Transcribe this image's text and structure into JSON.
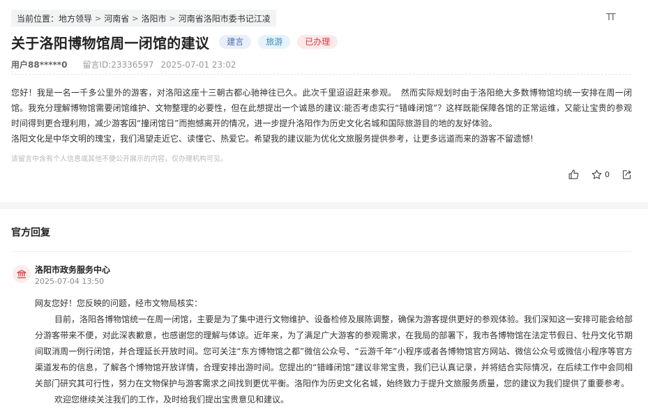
{
  "breadcrumb": {
    "prefix": "当前位置：",
    "items": [
      "地方领导",
      "河南省",
      "洛阳市",
      "河南省洛阳市委书记江凌"
    ]
  },
  "font_size_button": "TT",
  "message": {
    "title": "关于洛阳博物馆周一闭馆的建议",
    "tags": [
      "建言",
      "旅游",
      "已办理"
    ],
    "user": "用户88*****0",
    "message_id": "留言ID:23336597",
    "date": "2025-07-01 23:02",
    "paragraphs": [
      "您好！我是一名一千多公里外的游客，对洛阳这座十三朝古都心驰神往已久。此次千里迢迢赶来参观。　然而实际规划时由于洛阳绝大多数博物馆均统一安排在周一闭馆。我充分理解博物馆需要闭馆维护、文物整理的必要性，但在此想提出一个诚恳的建议:能否考虑实行“错峰闭馆”？这样既能保障各馆的正常运维，又能让宝贵的参观时间得到更合理利用，减少游客因“撞闭馆日”而抱憾离开的情况，进一步提升洛阳作为历史文化名城和国际旅游目的地的友好体验。",
      "洛阳文化是中华文明的瑰宝，我们渴望走近它、读懂它、热爱它。希望我的建议能为优化文旅服务提供参考，让更多远道而来的游客不留遗憾!"
    ],
    "notice": "该留言中含有个人信息或其他不便公开展示的内容，仅办理机构可见。",
    "actions": {
      "like_icon": "thumbs-up-icon",
      "favorite_icon": "star-icon",
      "favorite_count": "0",
      "share_icon": "share-icon"
    }
  },
  "reply": {
    "section_title": "官方回复",
    "org_name": "洛阳市政务服务中心",
    "org_icon": "government-building-icon",
    "time": "2025-07-04 13:50",
    "greeting": "网友您好！您反映的问题，经市文物局核实：",
    "paragraphs": [
      "目前，洛阳各博物馆统一在周一闭馆，主要是为了集中进行文物维护、设备检修及展陈调整，确保为游客提供更好的参观体验。我们深知这一安排可能会给部分游客带来不便，对此深表歉意，也感谢您的理解与体谅。近年来，为了满足广大游客的参观需求，在我局的部署下，我市各博物馆在法定节假日、牡丹文化节期间取消周一例行闭馆，并合理延长开放时间。您可关注“东方博物馆之都”微信公众号、“云游千年”小程序或者各博物馆官方网站、微信公众号或微信小程序等官方渠道发布的信息，了解各个博物馆开放详情，合理安排出游时间。您提出的“错峰闭馆”建议非常宝贵，我们已认真记录，并将结合实际情况，在后续工作中会同相关部门研究其可行性，努力在文物保护与游客需求之间找到更优平衡。洛阳作为历史文化名城，始终致力于提升文旅服务质量，您的建议为我们提供了重要参考。",
      "欢迎您继续关注我们的工作，及时给我们提出宝贵意见和建议。"
    ]
  },
  "colors": {
    "tag_suggest": "#4a6fb5",
    "tag_travel": "#3a8bb8",
    "tag_done": "#d9363e",
    "org_icon": "#d9363e"
  }
}
